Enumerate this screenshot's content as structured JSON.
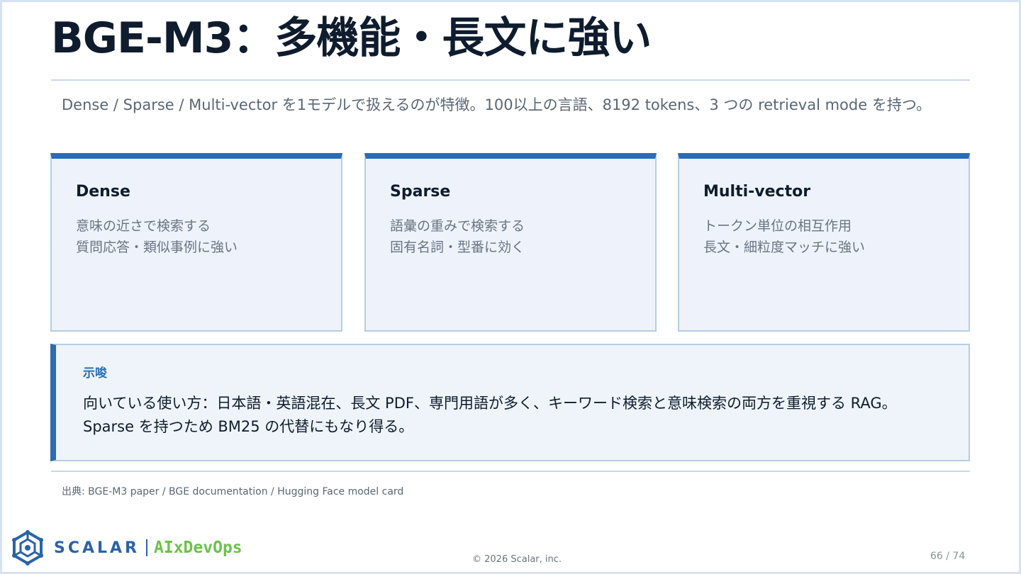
{
  "slide": {
    "title": "BGE-M3：多機能・長文に強い",
    "lead": "Dense / Sparse / Multi-vector を1モデルで扱えるのが特徴。100以上の言語、8192 tokens、3 つの retrieval mode を持つ。"
  },
  "cards": [
    {
      "title": "Dense",
      "lines": [
        "意味の近さで検索する",
        "質問応答・類似事例に強い"
      ]
    },
    {
      "title": "Sparse",
      "lines": [
        "語彙の重みで検索する",
        "固有名詞・型番に効く"
      ]
    },
    {
      "title": "Multi-vector",
      "lines": [
        "トークン単位の相互作用",
        "長文・細粒度マッチに強い"
      ]
    }
  ],
  "callout": {
    "label": "示唆",
    "body": "向いている使い方：日本語・英語混在、長文 PDF、専門用語が多く、キーワード検索と意味検索の両方を重視する RAG。Sparse を持つため BM25 の代替にもなり得る。"
  },
  "source": "出典: BGE-M3 paper / BGE documentation / Hugging Face model card",
  "footer": {
    "logo_brand": "SCALAR",
    "logo_product": "AIxDevOps",
    "copyright": "© 2026 Scalar, inc.",
    "page": "66 / 74"
  },
  "colors": {
    "accent": "#2b6cb4",
    "title": "#0f1c2e",
    "card_bg": "#eef3fb",
    "logo_blue": "#2a63a8",
    "logo_green": "#6cc24a"
  },
  "icons": {
    "logo": "scalar-hexagon-logo-icon"
  }
}
